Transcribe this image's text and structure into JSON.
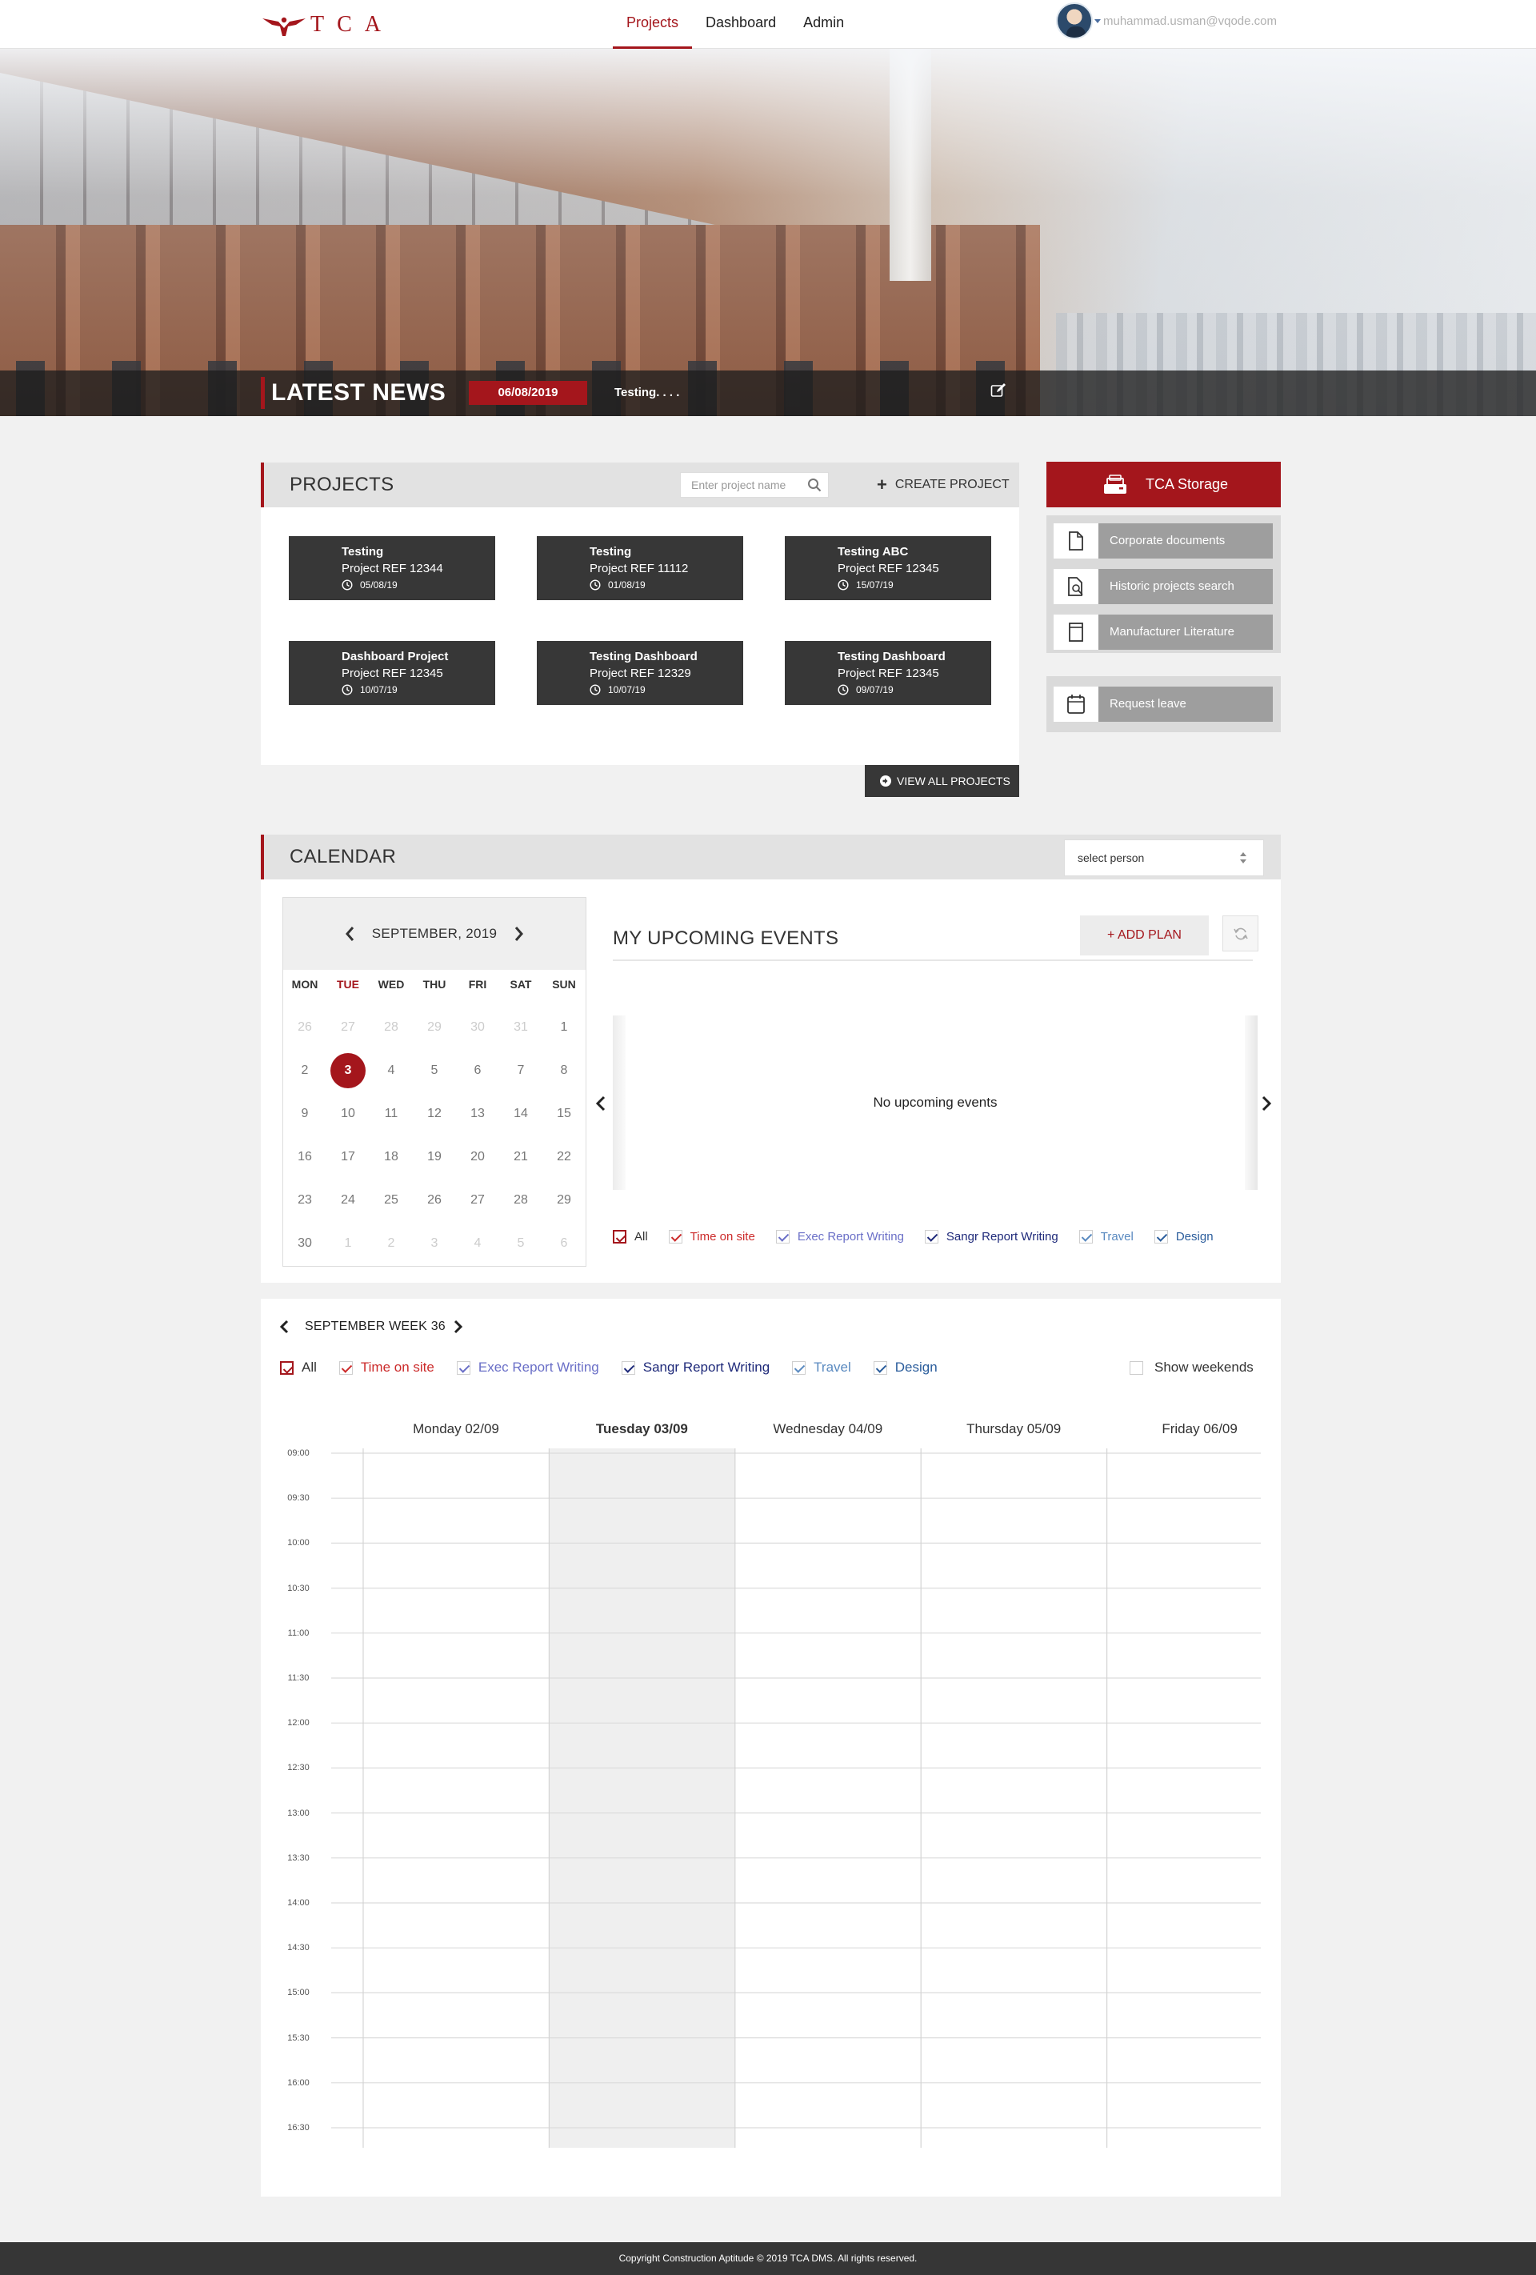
{
  "brand": {
    "logo_text": "TCA"
  },
  "nav": {
    "items": [
      {
        "label": "Projects",
        "active": true
      },
      {
        "label": "Dashboard",
        "active": false
      },
      {
        "label": "Admin",
        "active": false
      }
    ]
  },
  "user": {
    "email": "muhammad.usman@vqode.com"
  },
  "news": {
    "title": "LATEST NEWS",
    "date": "06/08/2019",
    "text": "Testing. . . ."
  },
  "projects": {
    "title": "PROJECTS",
    "search_placeholder": "Enter project name",
    "create_label": "CREATE PROJECT",
    "view_all_label": "VIEW ALL PROJECTS",
    "cards": [
      {
        "name": "Testing",
        "ref": "Project REF 12344",
        "date": "05/08/19"
      },
      {
        "name": "Testing",
        "ref": "Project REF 11112",
        "date": "01/08/19"
      },
      {
        "name": "Testing ABC",
        "ref": "Project REF 12345",
        "date": "15/07/19"
      },
      {
        "name": "Dashboard Project",
        "ref": "Project REF 12345",
        "date": "10/07/19"
      },
      {
        "name": "Testing Dashboard",
        "ref": "Project REF 12329",
        "date": "10/07/19"
      },
      {
        "name": "Testing Dashboard",
        "ref": "Project REF 12345",
        "date": "09/07/19"
      }
    ]
  },
  "storage": {
    "title": "TCA Storage",
    "items": [
      {
        "label": "Corporate documents",
        "icon": "document-icon"
      },
      {
        "label": "Historic projects search",
        "icon": "document-search-icon"
      },
      {
        "label": "Manufacturer Literature",
        "icon": "book-icon"
      }
    ],
    "leave": {
      "label": "Request leave",
      "icon": "calendar-icon"
    }
  },
  "calendar": {
    "title": "CALENDAR",
    "select_person": "select person",
    "month_label": "SEPTEMBER, 2019",
    "weekdays": [
      "MON",
      "TUE",
      "WED",
      "THU",
      "FRI",
      "SAT",
      "SUN"
    ],
    "today_weekday_index": 1,
    "days": [
      [
        "26",
        "27",
        "28",
        "29",
        "30",
        "31",
        "1"
      ],
      [
        "2",
        "3",
        "4",
        "5",
        "6",
        "7",
        "8"
      ],
      [
        "9",
        "10",
        "11",
        "12",
        "13",
        "14",
        "15"
      ],
      [
        "16",
        "17",
        "18",
        "19",
        "20",
        "21",
        "22"
      ],
      [
        "23",
        "24",
        "25",
        "26",
        "27",
        "28",
        "29"
      ],
      [
        "30",
        "1",
        "2",
        "3",
        "4",
        "5",
        "6"
      ]
    ],
    "muted_days": {
      "0": [
        0,
        1,
        2,
        3,
        4,
        5
      ],
      "5": [
        1,
        2,
        3,
        4,
        5,
        6
      ]
    },
    "today": {
      "row": 1,
      "col": 1
    },
    "events_title": "MY UPCOMING EVENTS",
    "add_plan_label": "+ ADD PLAN",
    "no_events": "No upcoming events",
    "filters": [
      {
        "label": "All",
        "color": "#333333",
        "check": "#a4161c"
      },
      {
        "label": "Time on site",
        "color": "#cc2b2b",
        "check": "#cc2b2b"
      },
      {
        "label": "Exec Report Writing",
        "color": "#6a6fc7",
        "check": "#6a6fc7"
      },
      {
        "label": "Sangr Report Writing",
        "color": "#1f2a7a",
        "check": "#1f2a7a"
      },
      {
        "label": "Travel",
        "color": "#5a8ac0",
        "check": "#5a8ac0"
      },
      {
        "label": "Design",
        "color": "#2b5d9c",
        "check": "#2b5d9c"
      }
    ]
  },
  "week": {
    "title": "SEPTEMBER WEEK 36",
    "show_weekends_label": "Show weekends",
    "days": [
      "Monday 02/09",
      "Tuesday 03/09",
      "Wednesday 04/09",
      "Thursday 05/09",
      "Friday 06/09"
    ],
    "today_index": 1,
    "times": [
      "09:00",
      "09:30",
      "10:00",
      "10:30",
      "11:00",
      "11:30",
      "12:00",
      "12:30",
      "13:00",
      "13:30",
      "14:00",
      "14:30",
      "15:00",
      "15:30",
      "16:00",
      "16:30"
    ]
  },
  "footer": {
    "text": "Copyright Construction Aptitude © 2019 TCA DMS. All rights reserved."
  },
  "colors": {
    "brand_red": "#a4161c",
    "dark_card": "#373737",
    "panel_gray": "#e2e2e2"
  }
}
